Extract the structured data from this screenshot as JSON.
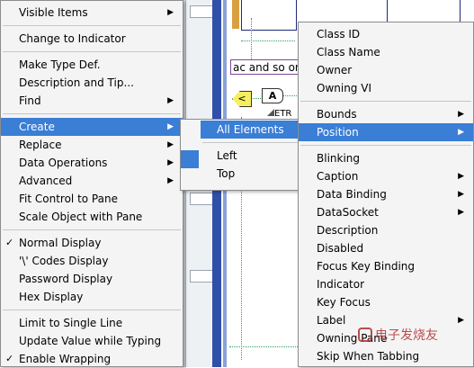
{
  "main_menu": {
    "items": [
      {
        "label": "Visible Items",
        "submenu": true
      },
      {
        "sep": true
      },
      {
        "label": "Change to Indicator"
      },
      {
        "sep": true
      },
      {
        "label": "Make Type Def."
      },
      {
        "label": "Description and Tip..."
      },
      {
        "label": "Find",
        "submenu": true
      },
      {
        "sep": true
      },
      {
        "label": "Create",
        "submenu": true,
        "selected": true
      },
      {
        "label": "Replace",
        "submenu": true
      },
      {
        "label": "Data Operations",
        "submenu": true
      },
      {
        "label": "Advanced",
        "submenu": true
      },
      {
        "label": "Fit Control to Pane"
      },
      {
        "label": "Scale Object with Pane"
      },
      {
        "sep": true
      },
      {
        "label": "Normal Display",
        "checked": true
      },
      {
        "label": "'\\' Codes Display"
      },
      {
        "label": "Password Display"
      },
      {
        "label": "Hex Display"
      },
      {
        "sep": true
      },
      {
        "label": "Limit to Single Line"
      },
      {
        "label": "Update Value while Typing"
      },
      {
        "label": "Enable Wrapping",
        "checked": true
      }
    ]
  },
  "create_menu": {
    "items": [
      {
        "label": "All Elements",
        "selected": true
      },
      {
        "sep": true
      },
      {
        "label": "Left"
      },
      {
        "label": "Top"
      }
    ]
  },
  "property_menu": {
    "items": [
      {
        "label": "Class ID"
      },
      {
        "label": "Class Name"
      },
      {
        "label": "Owner"
      },
      {
        "label": "Owning VI"
      },
      {
        "sep": true
      },
      {
        "label": "Bounds",
        "submenu": true
      },
      {
        "label": "Position",
        "submenu": true,
        "selected": true
      },
      {
        "sep": true
      },
      {
        "label": "Blinking"
      },
      {
        "label": "Caption",
        "submenu": true
      },
      {
        "label": "Data Binding",
        "submenu": true
      },
      {
        "label": "DataSocket",
        "submenu": true
      },
      {
        "label": "Description"
      },
      {
        "label": "Disabled"
      },
      {
        "label": "Focus Key Binding"
      },
      {
        "label": "Indicator"
      },
      {
        "label": "Key Focus"
      },
      {
        "label": "Label",
        "submenu": true
      },
      {
        "label": "Owning Pane"
      },
      {
        "label": "Skip When Tabbing"
      }
    ]
  },
  "diagram": {
    "string_constant": "ac and so on",
    "node_a": "A",
    "node_lt": "<",
    "etr_label": "ETR"
  },
  "watermark": {
    "text": "电子发烧友"
  },
  "glyphs": {
    "arrow": "▶",
    "check": "✓"
  }
}
